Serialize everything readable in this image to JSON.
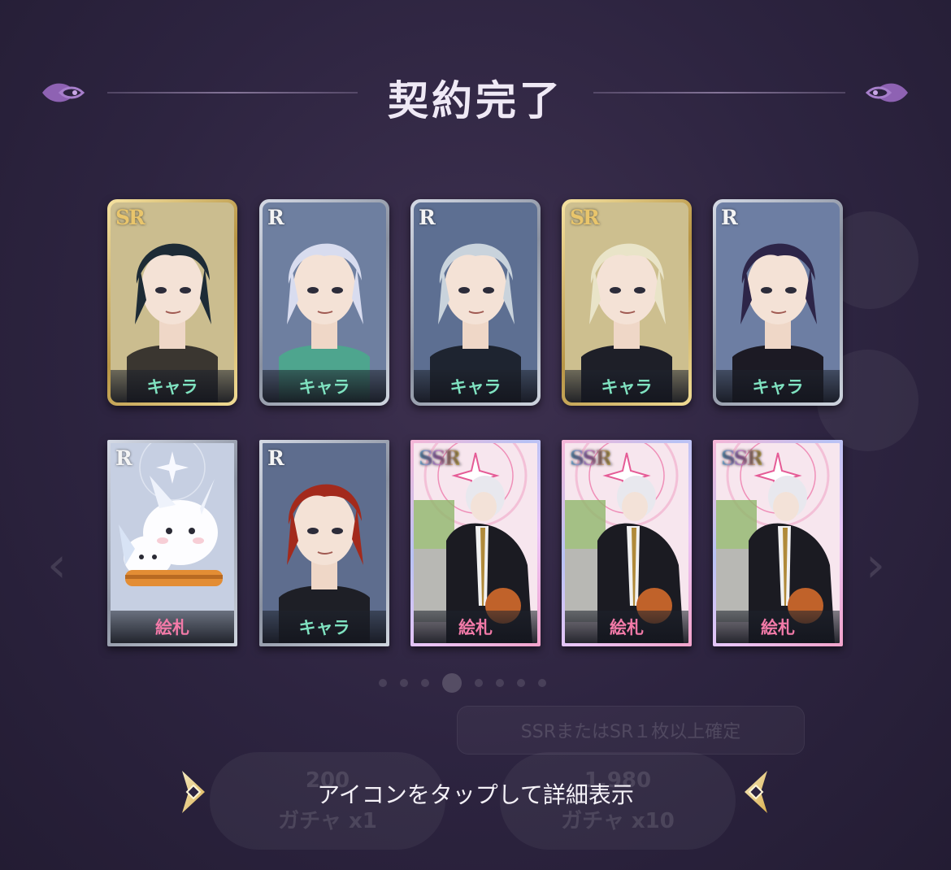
{
  "header": {
    "title": "契約完了"
  },
  "cards": [
    {
      "rarity": "SR",
      "type_label": "キャラ",
      "kind": "chara",
      "frame": "gold",
      "colors": {
        "hair": "#1d2b36",
        "bg": "#cbbd8f",
        "cloth": "#3a3630"
      }
    },
    {
      "rarity": "R",
      "type_label": "キャラ",
      "kind": "chara",
      "frame": "silver",
      "colors": {
        "hair": "#d8dcef",
        "bg": "#6e7fa0",
        "cloth": "#4ea58e"
      }
    },
    {
      "rarity": "R",
      "type_label": "キャラ",
      "kind": "chara",
      "frame": "silver",
      "colors": {
        "hair": "#c9d3dc",
        "bg": "#5d6f92",
        "cloth": "#1e2430"
      }
    },
    {
      "rarity": "SR",
      "type_label": "キャラ",
      "kind": "chara",
      "frame": "gold",
      "colors": {
        "hair": "#e9e4c8",
        "bg": "#cdbf8f",
        "cloth": "#1e1f28"
      }
    },
    {
      "rarity": "R",
      "type_label": "キャラ",
      "kind": "chara",
      "frame": "silver",
      "colors": {
        "hair": "#2d2548",
        "bg": "#6d7ea3",
        "cloth": "#1c1a24"
      }
    },
    {
      "rarity": "R",
      "type_label": "絵札",
      "kind": "efuda",
      "frame": "silver",
      "colors": {
        "hair": "#f4f6fb",
        "bg": "#c6cfe2",
        "cloth": "#e38d34"
      }
    },
    {
      "rarity": "R",
      "type_label": "キャラ",
      "kind": "chara",
      "frame": "silver",
      "colors": {
        "hair": "#a32a1c",
        "bg": "#5e6d8e",
        "cloth": "#1e1f26"
      }
    },
    {
      "rarity": "SSR",
      "type_label": "絵札",
      "kind": "efuda",
      "frame": "rainbow",
      "colors": {
        "hair": "#e8e8ee",
        "bg": "#f3c0d7",
        "cloth": "#1b1b22"
      }
    },
    {
      "rarity": "SSR",
      "type_label": "絵札",
      "kind": "efuda",
      "frame": "rainbow",
      "colors": {
        "hair": "#e8e8ee",
        "bg": "#f3c0d7",
        "cloth": "#1b1b22"
      }
    },
    {
      "rarity": "SSR",
      "type_label": "絵札",
      "kind": "efuda",
      "frame": "rainbow",
      "colors": {
        "hair": "#e8e8ee",
        "bg": "#f3c0d7",
        "cloth": "#1b1b22"
      }
    }
  ],
  "background": {
    "guarantee_text": "SSRまたはSR１枚以上確定",
    "gacha1": {
      "cost": "200",
      "label": "ガチャ x1"
    },
    "gacha10": {
      "cost": "1,980",
      "label": "ガチャ x10"
    }
  },
  "footer": {
    "hint": "アイコンをタップして詳細表示"
  }
}
